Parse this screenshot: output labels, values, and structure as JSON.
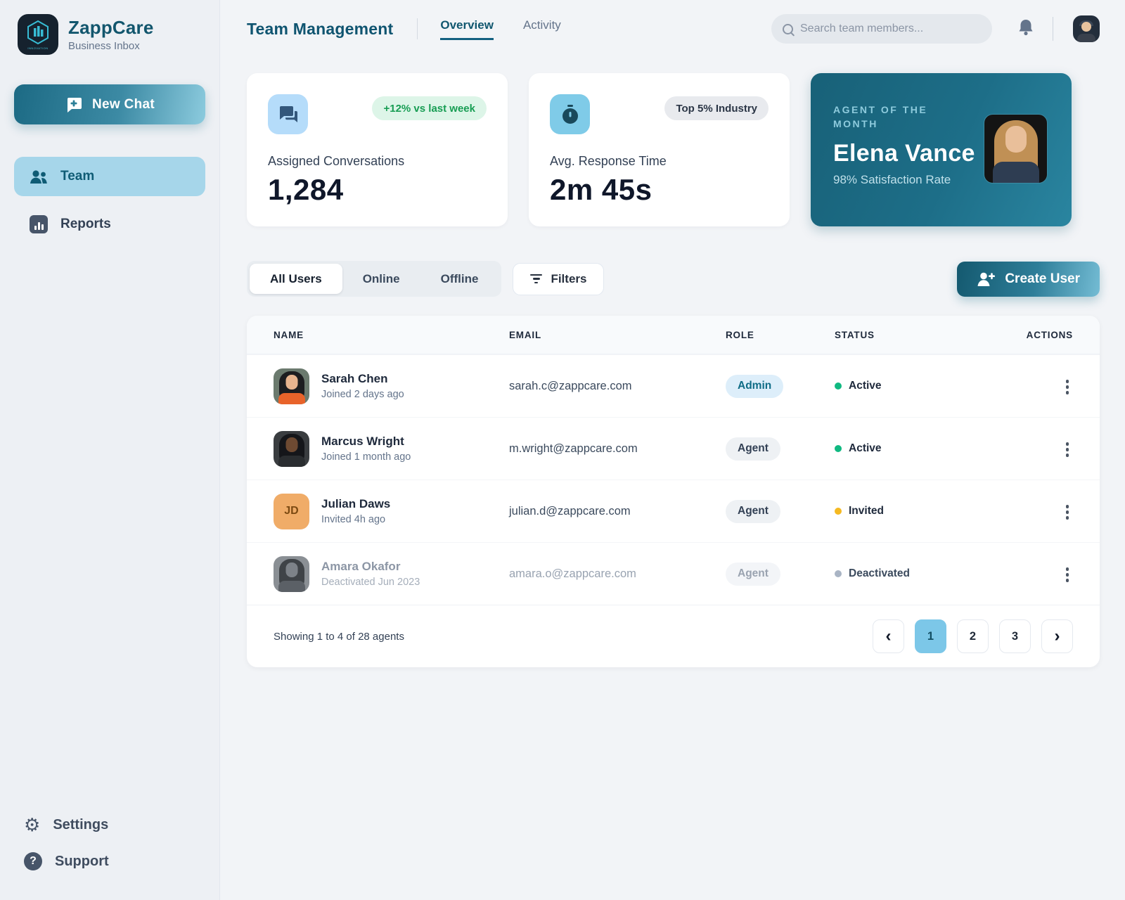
{
  "colors": {
    "accent_teal": "#176a84",
    "active_sky": "#7cc7e8",
    "status_active": "#10b981",
    "status_invited": "#f5b921",
    "status_deactivated": "#a9b4c4",
    "badge_green_text": "#179d53"
  },
  "sidebar": {
    "brand": {
      "name": "ZappCare",
      "subtitle": "Business Inbox"
    },
    "new_chat_label": "New Chat",
    "items": [
      {
        "label": "Team",
        "active": true
      },
      {
        "label": "Reports",
        "active": false
      }
    ],
    "footer_items": [
      {
        "label": "Settings"
      },
      {
        "label": "Support"
      }
    ]
  },
  "header": {
    "title": "Team Management",
    "tabs": [
      {
        "label": "Overview",
        "active": true
      },
      {
        "label": "Activity",
        "active": false
      }
    ],
    "search_placeholder": "Search team members..."
  },
  "stats": [
    {
      "icon": "chat-bubbles-icon",
      "badge": "+12% vs last week",
      "label": "Assigned Conversations",
      "value": "1,284"
    },
    {
      "icon": "stopwatch-icon",
      "badge": "Top 5% Industry",
      "label": "Avg. Response Time",
      "value": "2m 45s"
    }
  ],
  "agent_of_month": {
    "heading": "AGENT OF THE MONTH",
    "name": "Elena Vance",
    "stat": "98% Satisfaction Rate"
  },
  "filters": {
    "tabs": [
      "All Users",
      "Online",
      "Offline"
    ],
    "active_tab": "All Users",
    "filters_label": "Filters",
    "create_user_label": "Create User"
  },
  "table": {
    "columns": [
      "NAME",
      "EMAIL",
      "ROLE",
      "STATUS",
      "ACTIONS"
    ],
    "rows": [
      {
        "name": "Sarah Chen",
        "meta": "Joined 2 days ago",
        "email": "sarah.c@zappcare.com",
        "role": "Admin",
        "status": "Active",
        "status_type": "active"
      },
      {
        "name": "Marcus Wright",
        "meta": "Joined 1 month ago",
        "email": "m.wright@zappcare.com",
        "role": "Agent",
        "status": "Active",
        "status_type": "active"
      },
      {
        "name": "Julian Daws",
        "meta": "Invited 4h ago",
        "email": "julian.d@zappcare.com",
        "role": "Agent",
        "status": "Invited",
        "status_type": "invited",
        "initials": "JD"
      },
      {
        "name": "Amara Okafor",
        "meta": "Deactivated Jun 2023",
        "email": "amara.o@zappcare.com",
        "role": "Agent",
        "status": "Deactivated",
        "status_type": "deactivated"
      }
    ],
    "footer": {
      "summary": "Showing 1 to 4 of 28 agents",
      "pages": [
        "1",
        "2",
        "3"
      ],
      "active_page": "1",
      "prev_label": "‹",
      "next_label": "›"
    }
  }
}
